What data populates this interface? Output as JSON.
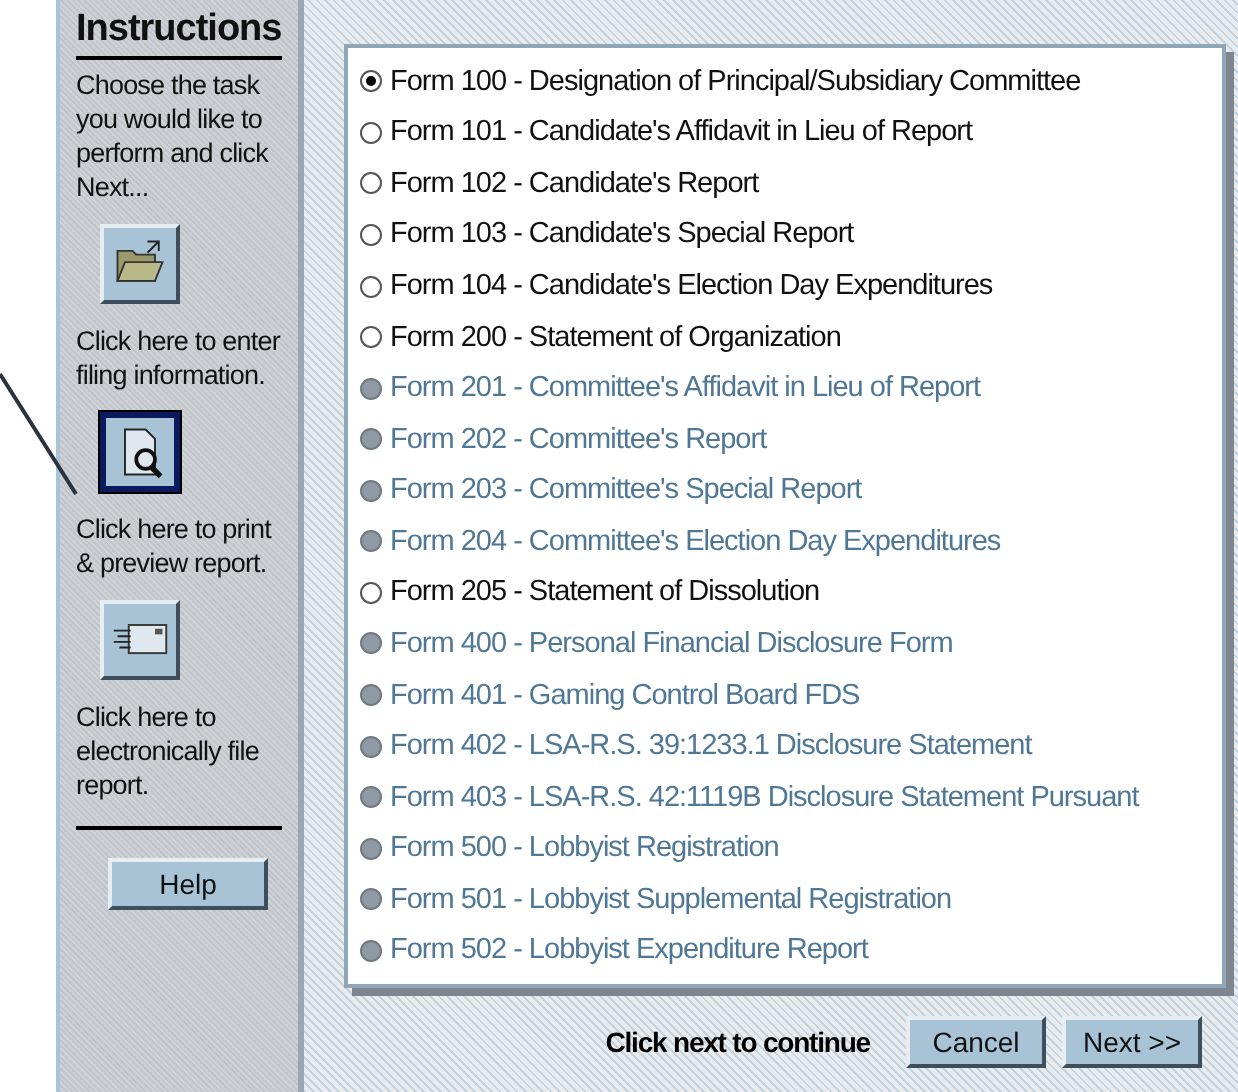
{
  "instructions": {
    "title": "Instructions",
    "intro": "Choose the task you would like to perform and click Next...",
    "tasks": [
      {
        "kind": "folder",
        "caption": "Click here to enter filing information.",
        "selected": false
      },
      {
        "kind": "preview",
        "caption": "Click here to print & preview report.",
        "selected": true
      },
      {
        "kind": "mail",
        "caption": "Click here to electronically file report.",
        "selected": false
      }
    ],
    "help_button": "Help"
  },
  "forms": [
    {
      "label": "Form 100 - Designation of Principal/Subsidiary Committee",
      "selected": true,
      "disabled": false
    },
    {
      "label": "Form 101 - Candidate's Affidavit in Lieu of Report",
      "selected": false,
      "disabled": false
    },
    {
      "label": "Form 102 - Candidate's Report",
      "selected": false,
      "disabled": false
    },
    {
      "label": "Form 103 - Candidate's Special Report",
      "selected": false,
      "disabled": false
    },
    {
      "label": "Form 104 - Candidate's Election Day Expenditures",
      "selected": false,
      "disabled": false
    },
    {
      "label": "Form 200 - Statement of Organization",
      "selected": false,
      "disabled": false
    },
    {
      "label": "Form 201 - Committee's Affidavit in Lieu of Report",
      "selected": false,
      "disabled": true
    },
    {
      "label": "Form 202 - Committee's Report",
      "selected": false,
      "disabled": true
    },
    {
      "label": "Form 203 - Committee's Special Report",
      "selected": false,
      "disabled": true
    },
    {
      "label": "Form 204 - Committee's Election Day Expenditures",
      "selected": false,
      "disabled": true
    },
    {
      "label": "Form 205 - Statement of Dissolution",
      "selected": false,
      "disabled": false
    },
    {
      "label": "Form 400 - Personal Financial Disclosure Form",
      "selected": false,
      "disabled": true
    },
    {
      "label": "Form 401 - Gaming Control Board FDS",
      "selected": false,
      "disabled": true
    },
    {
      "label": "Form 402 - LSA-R.S. 39:1233.1 Disclosure Statement",
      "selected": false,
      "disabled": true
    },
    {
      "label": "Form 403 - LSA-R.S. 42:1119B Disclosure Statement Pursuant",
      "selected": false,
      "disabled": true
    },
    {
      "label": "Form 500 - Lobbyist Registration",
      "selected": false,
      "disabled": true
    },
    {
      "label": "Form 501 - Lobbyist Supplemental Registration",
      "selected": false,
      "disabled": true
    },
    {
      "label": "Form 502 - Lobbyist Expenditure Report",
      "selected": false,
      "disabled": true
    }
  ],
  "footer": {
    "hint": "Click next to continue",
    "buttons": [
      "Cancel",
      "Next >>"
    ]
  }
}
